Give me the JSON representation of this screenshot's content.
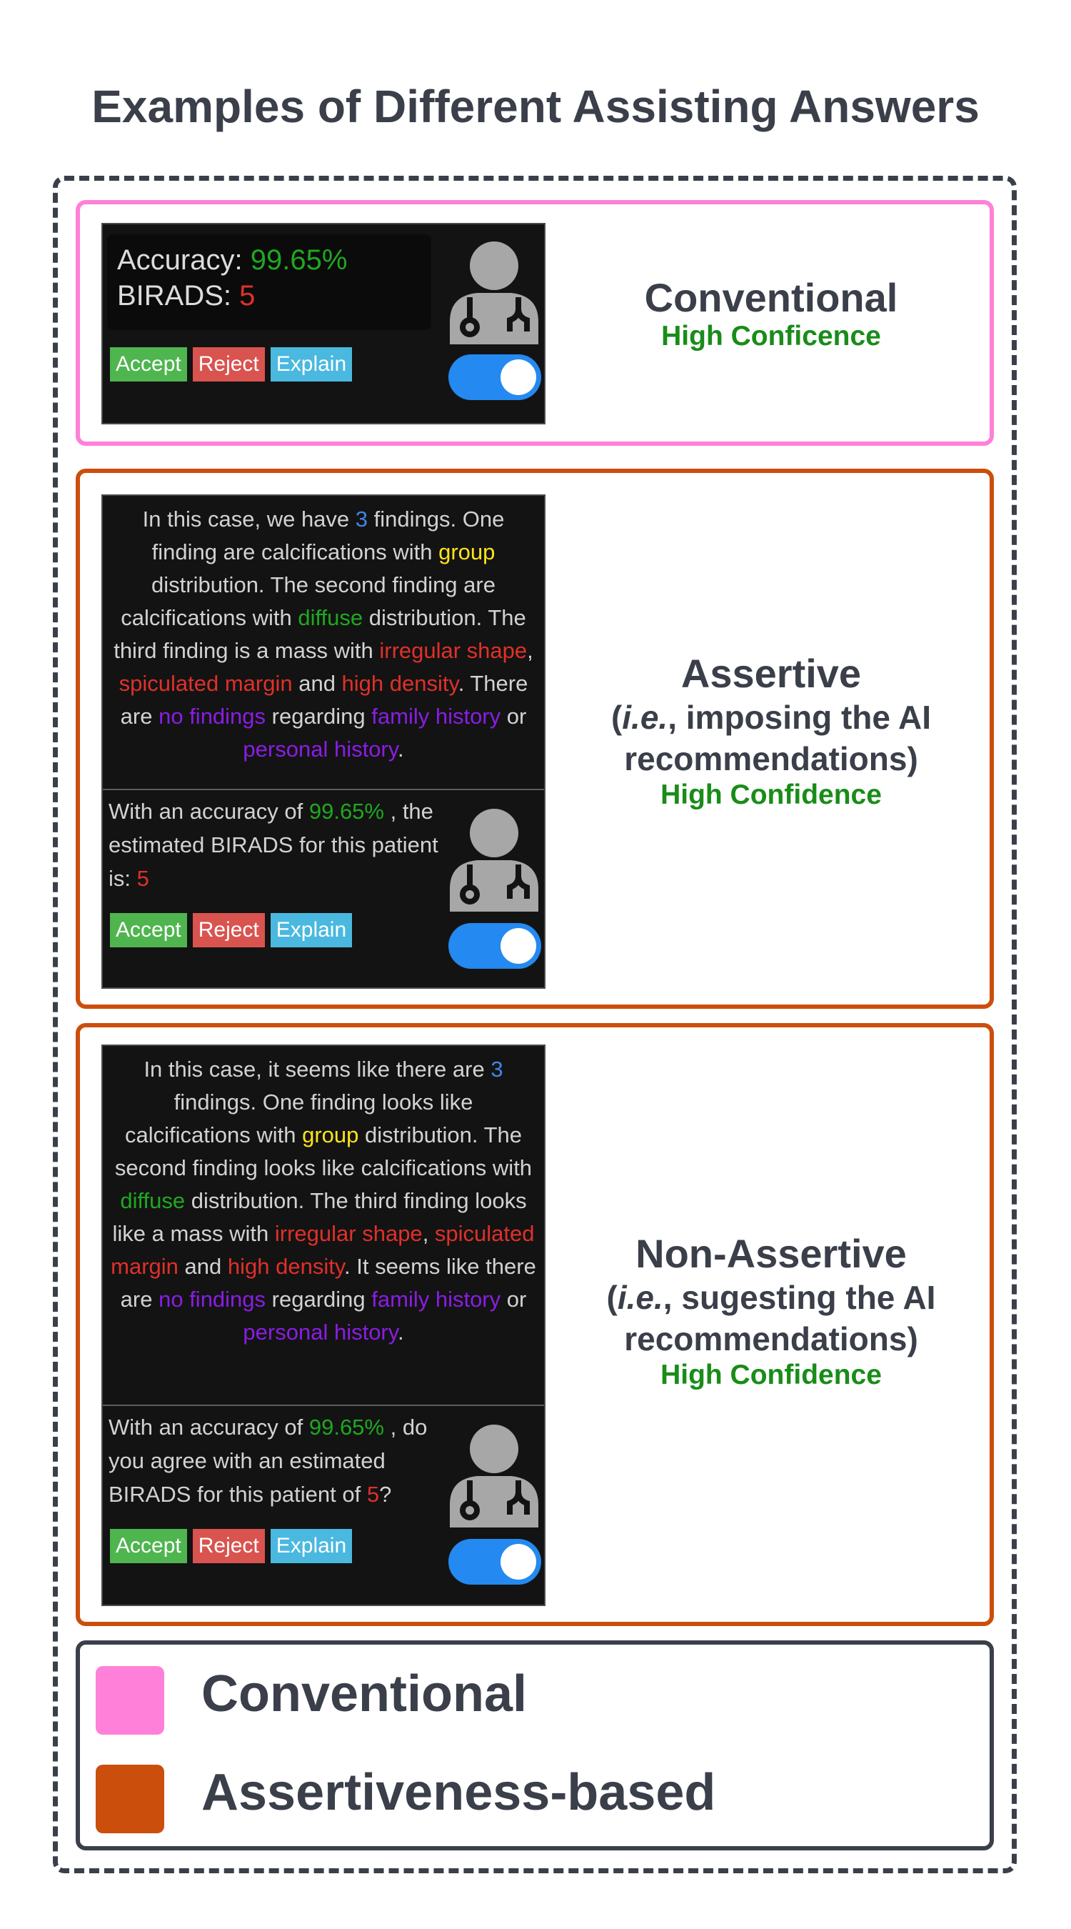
{
  "title": "Examples of Different Assisting Answers",
  "colors": {
    "conventional_border": "#ff80d8",
    "assertiveness_border": "#cc4e0c",
    "accuracy_green": "#1fa81f",
    "birads_red": "#e0302a",
    "toggle_blue": "#2489f0",
    "confidence_green": "#198c19"
  },
  "buttons": {
    "accept": "Accept",
    "reject": "Reject",
    "explain": "Explain"
  },
  "panels": [
    {
      "accuracy_label": "Accuracy: ",
      "accuracy_value": "99.65%",
      "birads_label": "BIRADS: ",
      "birads_value": "5",
      "heading": "Conventional",
      "confidence": "High Conficence"
    },
    {
      "findings": {
        "t1": "In this case, we have ",
        "count": "3",
        "t2": " findings. One finding are calcifications with ",
        "group": "group",
        "t3": " distribution. The second finding are calcifications with ",
        "diffuse": "diffuse",
        "t4": " distribution. The third finding is a mass with ",
        "irregular": "irregular shape",
        "t5": ", ",
        "spiculated": "spiculated margin",
        "t6": " and ",
        "density": "high density",
        "t7": ". There are ",
        "nofindings": "no findings",
        "t8": " regarding ",
        "family": "family history",
        "t9": " or ",
        "personal": "personal history",
        "t10": "."
      },
      "lower": {
        "t1": "With an accuracy of ",
        "accuracy": "99.65%",
        "t2": " , the estimated BIRADS for this patient is: ",
        "birads": "5"
      },
      "heading": "Assertive",
      "subtitle_ie": "i.e.",
      "subtitle_rest": ", imposing the AI recommendations)",
      "confidence": "High Confidence"
    },
    {
      "findings": {
        "t1": "In this case, it seems like there are ",
        "count": "3",
        "t2": " findings. One finding looks like calcifications with ",
        "group": "group",
        "t3": " distribution. The second finding looks like calcifications with ",
        "diffuse": "diffuse",
        "t4": " distribution. The third finding looks like a mass with ",
        "irregular": "irregular shape",
        "t5": ", ",
        "spiculated": "spiculated margin",
        "t6": " and ",
        "density": "high density",
        "t7": ". It seems like there are ",
        "nofindings": "no findings",
        "t8": " regarding ",
        "family": "family history",
        "t9": " or ",
        "personal": "personal history",
        "t10": "."
      },
      "lower": {
        "t1": "With an accuracy of ",
        "accuracy": "99.65%",
        "t2": " , do you agree with an estimated BIRADS for this patient of ",
        "birads": "5",
        "t3": "?"
      },
      "heading": "Non-Assertive",
      "subtitle_ie": "i.e.",
      "subtitle_rest": ", sugesting the AI recommendations)",
      "confidence": "High Confidence"
    }
  ],
  "legend": [
    {
      "label": "Conventional"
    },
    {
      "label": "Assertiveness-based"
    }
  ],
  "icons": [
    "doctor-icon",
    "toggle-switch"
  ]
}
